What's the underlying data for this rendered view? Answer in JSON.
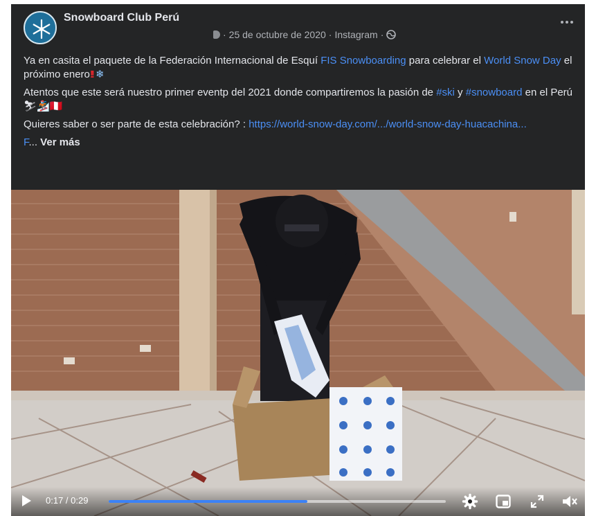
{
  "post": {
    "page_name": "Snowboard Club Perú",
    "timestamp": "25 de octubre de 2020",
    "separator": "·",
    "source": "Instagram",
    "privacy_icon": "globe-icon",
    "more_icon": "more-options-icon",
    "paragraph1": {
      "before": "Ya en casita el paquete de la Federación Internacional de Esquí ",
      "link1": "FIS Snowboarding",
      "middle": " para celebrar el ",
      "link2": "World Snow Day",
      "after": " el próximo enero",
      "emoji1": "!!",
      "emoji2": "❄"
    },
    "paragraph2": {
      "before": "Atentos que este será nuestro primer eventp del 2021 donde compartiremos la pasión de ",
      "hashtag1": "#ski",
      "middle": " y ",
      "hashtag2": "#snowboard",
      "after": " en el Perú ",
      "emoji": "⛷🏂🇵🇪"
    },
    "paragraph3": {
      "before": "Quieres saber o ser parte de esta celebración? : ",
      "link": "https://world-snow-day.com/.../world-snow-day-huacachina..."
    },
    "paragraph4": {
      "link": "F",
      "ellipsis": "... ",
      "see_more": "Ver más"
    }
  },
  "video": {
    "current_time": "0:17",
    "duration": "0:29",
    "time_separator": " / ",
    "progress": 0.59,
    "accent": "#3b82f6",
    "icons": [
      "play-icon",
      "settings-gear-icon",
      "picture-in-picture-icon",
      "fullscreen-icon",
      "volume-muted-icon"
    ]
  }
}
